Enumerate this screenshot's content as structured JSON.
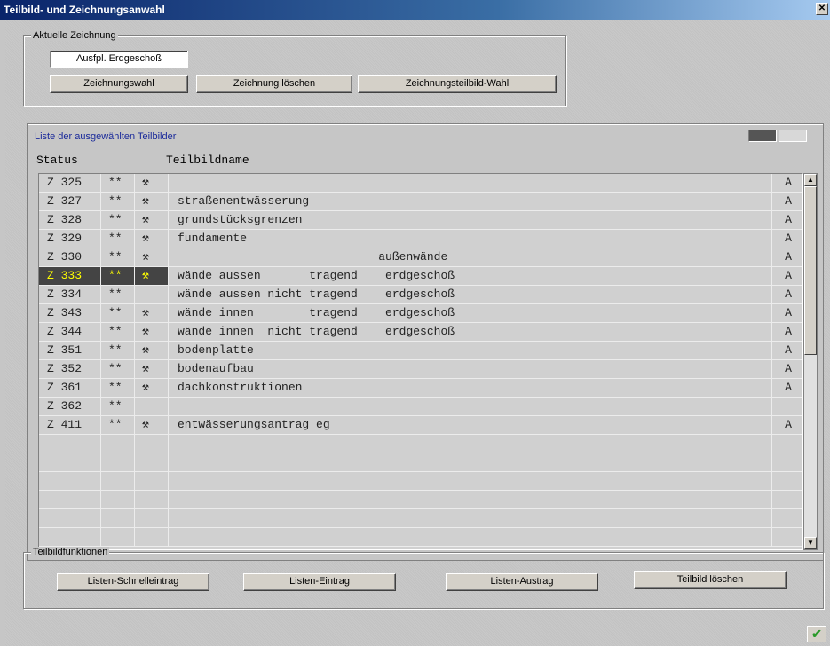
{
  "window": {
    "title": "Teilbild- und Zeichnungsanwahl",
    "close_glyph": "✕"
  },
  "current_drawing": {
    "group_label": "Aktuelle Zeichnung",
    "value": "Ausfpl. Erdgeschoß",
    "buttons": {
      "select": "Zeichnungswahl",
      "delete": "Zeichnung löschen",
      "partial_select": "Zeichnungsteilbild-Wahl"
    }
  },
  "list": {
    "title": "Liste der ausgewählten Teilbilder",
    "columns": {
      "status": "Status",
      "name": "Teilbildname"
    },
    "icon_glyph": "⚒",
    "rows": [
      {
        "status": "Z 325",
        "stars": "**",
        "icon": true,
        "name": "",
        "flag": "A",
        "selected": false
      },
      {
        "status": "Z 327",
        "stars": "**",
        "icon": true,
        "name": "straßenentwässerung",
        "flag": "A",
        "selected": false
      },
      {
        "status": "Z 328",
        "stars": "**",
        "icon": true,
        "name": "grundstücksgrenzen",
        "flag": "A",
        "selected": false
      },
      {
        "status": "Z 329",
        "stars": "**",
        "icon": true,
        "name": "fundamente",
        "flag": "A",
        "selected": false
      },
      {
        "status": "Z 330",
        "stars": "**",
        "icon": true,
        "name": "                             außenwände",
        "flag": "A",
        "selected": false
      },
      {
        "status": "Z 333",
        "stars": "**",
        "icon": true,
        "name": "wände aussen       tragend    erdgeschoß",
        "flag": "A",
        "selected": true
      },
      {
        "status": "Z 334",
        "stars": "**",
        "icon": false,
        "name": "wände aussen nicht tragend    erdgeschoß",
        "flag": "A",
        "selected": false
      },
      {
        "status": "Z 343",
        "stars": "**",
        "icon": true,
        "name": "wände innen        tragend    erdgeschoß",
        "flag": "A",
        "selected": false
      },
      {
        "status": "Z 344",
        "stars": "**",
        "icon": true,
        "name": "wände innen  nicht tragend    erdgeschoß",
        "flag": "A",
        "selected": false
      },
      {
        "status": "Z 351",
        "stars": "**",
        "icon": true,
        "name": "bodenplatte",
        "flag": "A",
        "selected": false
      },
      {
        "status": "Z 352",
        "stars": "**",
        "icon": true,
        "name": "bodenaufbau",
        "flag": "A",
        "selected": false
      },
      {
        "status": "Z 361",
        "stars": "**",
        "icon": true,
        "name": "dachkonstruktionen",
        "flag": "A",
        "selected": false
      },
      {
        "status": "Z 362",
        "stars": "**",
        "icon": false,
        "name": "",
        "flag": "",
        "selected": false
      },
      {
        "status": "Z 411",
        "stars": "**",
        "icon": true,
        "name": "entwässerungsantrag eg",
        "flag": "A",
        "selected": false
      },
      {
        "status": "",
        "stars": "",
        "icon": false,
        "name": "",
        "flag": "",
        "selected": false
      },
      {
        "status": "",
        "stars": "",
        "icon": false,
        "name": "",
        "flag": "",
        "selected": false
      },
      {
        "status": "",
        "stars": "",
        "icon": false,
        "name": "",
        "flag": "",
        "selected": false
      },
      {
        "status": "",
        "stars": "",
        "icon": false,
        "name": "",
        "flag": "",
        "selected": false
      },
      {
        "status": "",
        "stars": "",
        "icon": false,
        "name": "",
        "flag": "",
        "selected": false
      },
      {
        "status": "",
        "stars": "",
        "icon": false,
        "name": "",
        "flag": "",
        "selected": false
      }
    ]
  },
  "functions": {
    "group_label": "Teilbildfunktionen",
    "buttons": {
      "quick_entry": "Listen-Schnelleintrag",
      "entry": "Listen-Eintrag",
      "removal": "Listen-Austrag",
      "delete": "Teilbild löschen"
    }
  },
  "footer": {
    "ok_glyph": "✔"
  }
}
